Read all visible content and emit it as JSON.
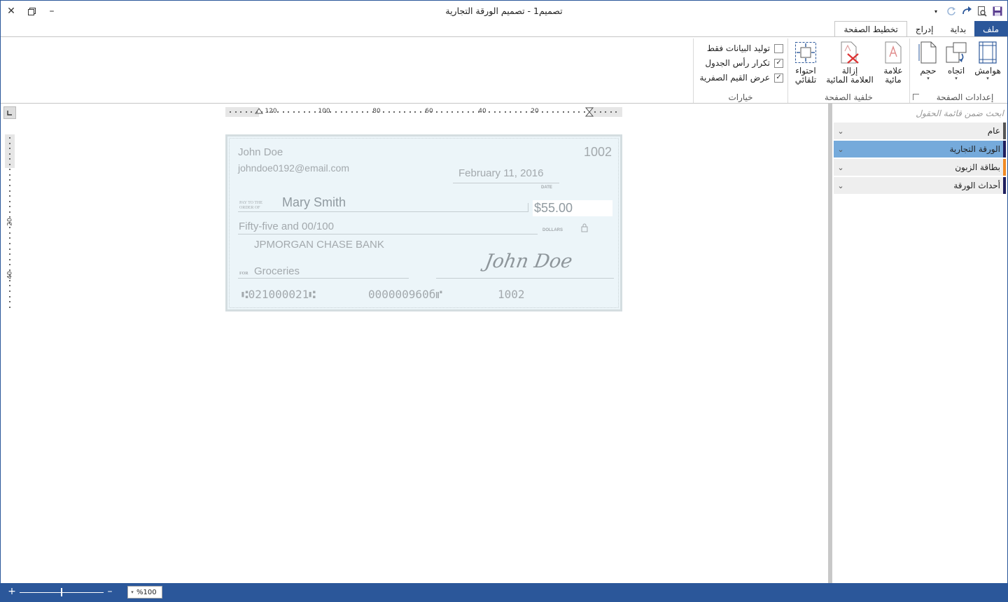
{
  "window": {
    "title": "تصميم1 - تصميم الورقة التجارية"
  },
  "tabs": [
    {
      "label": "ملف"
    },
    {
      "label": "بداية"
    },
    {
      "label": "إدراج"
    },
    {
      "label": "تخطيط الصفحة"
    }
  ],
  "ribbon": {
    "page_setup": {
      "label": "إعدادات الصفحة",
      "margins": "هوامش",
      "orientation": "اتجاه",
      "size": "حجم"
    },
    "page_background": {
      "label": "خلفية الصفحة",
      "watermark_line1": "علامة",
      "watermark_line2": "مائية",
      "remove_watermark_line1": "إزالة",
      "remove_watermark_line2": "العلامة المائية",
      "auto_fit_line1": "احتواء",
      "auto_fit_line2": "تلقائي"
    },
    "options": {
      "label": "خيارات",
      "items": [
        {
          "label": "توليد البيانات فقط",
          "checked": false,
          "mark": ""
        },
        {
          "label": "تكرار رأس الجدول",
          "checked": true,
          "mark": "✓"
        },
        {
          "label": "عرض القيم الصفرية",
          "checked": true,
          "mark": "✓"
        }
      ]
    }
  },
  "ruler": {
    "h_labels": [
      "120",
      "100",
      "80",
      "60",
      "40",
      "20"
    ],
    "v_labels": [
      "20",
      "40"
    ]
  },
  "check": {
    "name": "John Doe",
    "email": "johndoe0192@email.com",
    "number": "1002",
    "date": "February 11, 2016",
    "date_caption": "DATE",
    "pay_to_caption_1": "PAY TO THE",
    "pay_to_caption_2": "ORDER OF",
    "payee": "Mary Smith",
    "amount": "$55.00",
    "amount_words": "Fifty-five and 00/100",
    "dollars_caption": "DOLLARS",
    "bank": "JPMORGAN CHASE BANK",
    "for_caption": "FOR",
    "memo": "Groceries",
    "signature": "John Doe",
    "micr_routing": "⑆021000021⑆",
    "micr_account": "000000960б⑈",
    "micr_check": "1002"
  },
  "field_list": {
    "search_placeholder": "ابحث ضمن قائمة الحقول",
    "items": [
      {
        "label": "عام",
        "stripe": "#555555"
      },
      {
        "label": "الورقة التجارية",
        "stripe": "#1f1f5e"
      },
      {
        "label": "بطاقة الزبون",
        "stripe": "#f08a24"
      },
      {
        "label": "أحداث الورقة",
        "stripe": "#1f1f5e"
      }
    ]
  },
  "status": {
    "zoom": "%100"
  },
  "colors": {
    "accent": "#2b579a",
    "selected_field": "#75aadb"
  }
}
